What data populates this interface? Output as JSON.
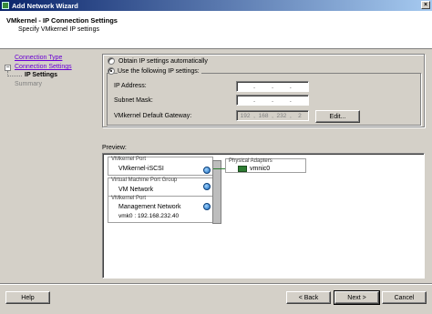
{
  "window": {
    "title": "Add Network Wizard",
    "close_glyph": "×"
  },
  "header": {
    "title": "VMkernel - IP Connection Settings",
    "subtitle": "Specify VMkernel IP settings"
  },
  "nav": {
    "items": [
      {
        "label": "Connection Type"
      },
      {
        "label": "Connection Settings"
      },
      {
        "label": "IP Settings"
      },
      {
        "label": "Summary"
      }
    ],
    "tree_toggle": "−"
  },
  "ip_settings": {
    "auto_label": "Obtain IP settings automatically",
    "manual_label": "Use the following IP settings:",
    "selected": "manual",
    "ip_address_label": "IP Address:",
    "subnet_mask_label": "Subnet Mask:",
    "gateway_label": "VMkernel Default Gateway:",
    "ip_address": [
      "",
      "",
      "",
      ""
    ],
    "subnet_mask": [
      "",
      "",
      "",
      ""
    ],
    "gateway": [
      "192",
      "168",
      "232",
      "2"
    ],
    "edit_button": "Edit..."
  },
  "preview": {
    "label": "Preview:",
    "port_groups": [
      {
        "type": "VMkernel Port",
        "name": "VMkernel-iSCSI",
        "detail": ""
      },
      {
        "type": "Virtual Machine Port Group",
        "name": "VM Network",
        "detail": ""
      },
      {
        "type": "VMkernel Port",
        "name": "Management Network",
        "detail": "vmk0 : 192.168.232.40"
      }
    ],
    "adapters_header": "Physical Adapters",
    "adapter": "vmnic0"
  },
  "footer": {
    "help": "Help",
    "back": "< Back",
    "next": "Next >",
    "cancel": "Cancel"
  },
  "icons": {
    "app": "network-wizard-icon",
    "port": "globe-icon",
    "nic": "nic-icon"
  }
}
